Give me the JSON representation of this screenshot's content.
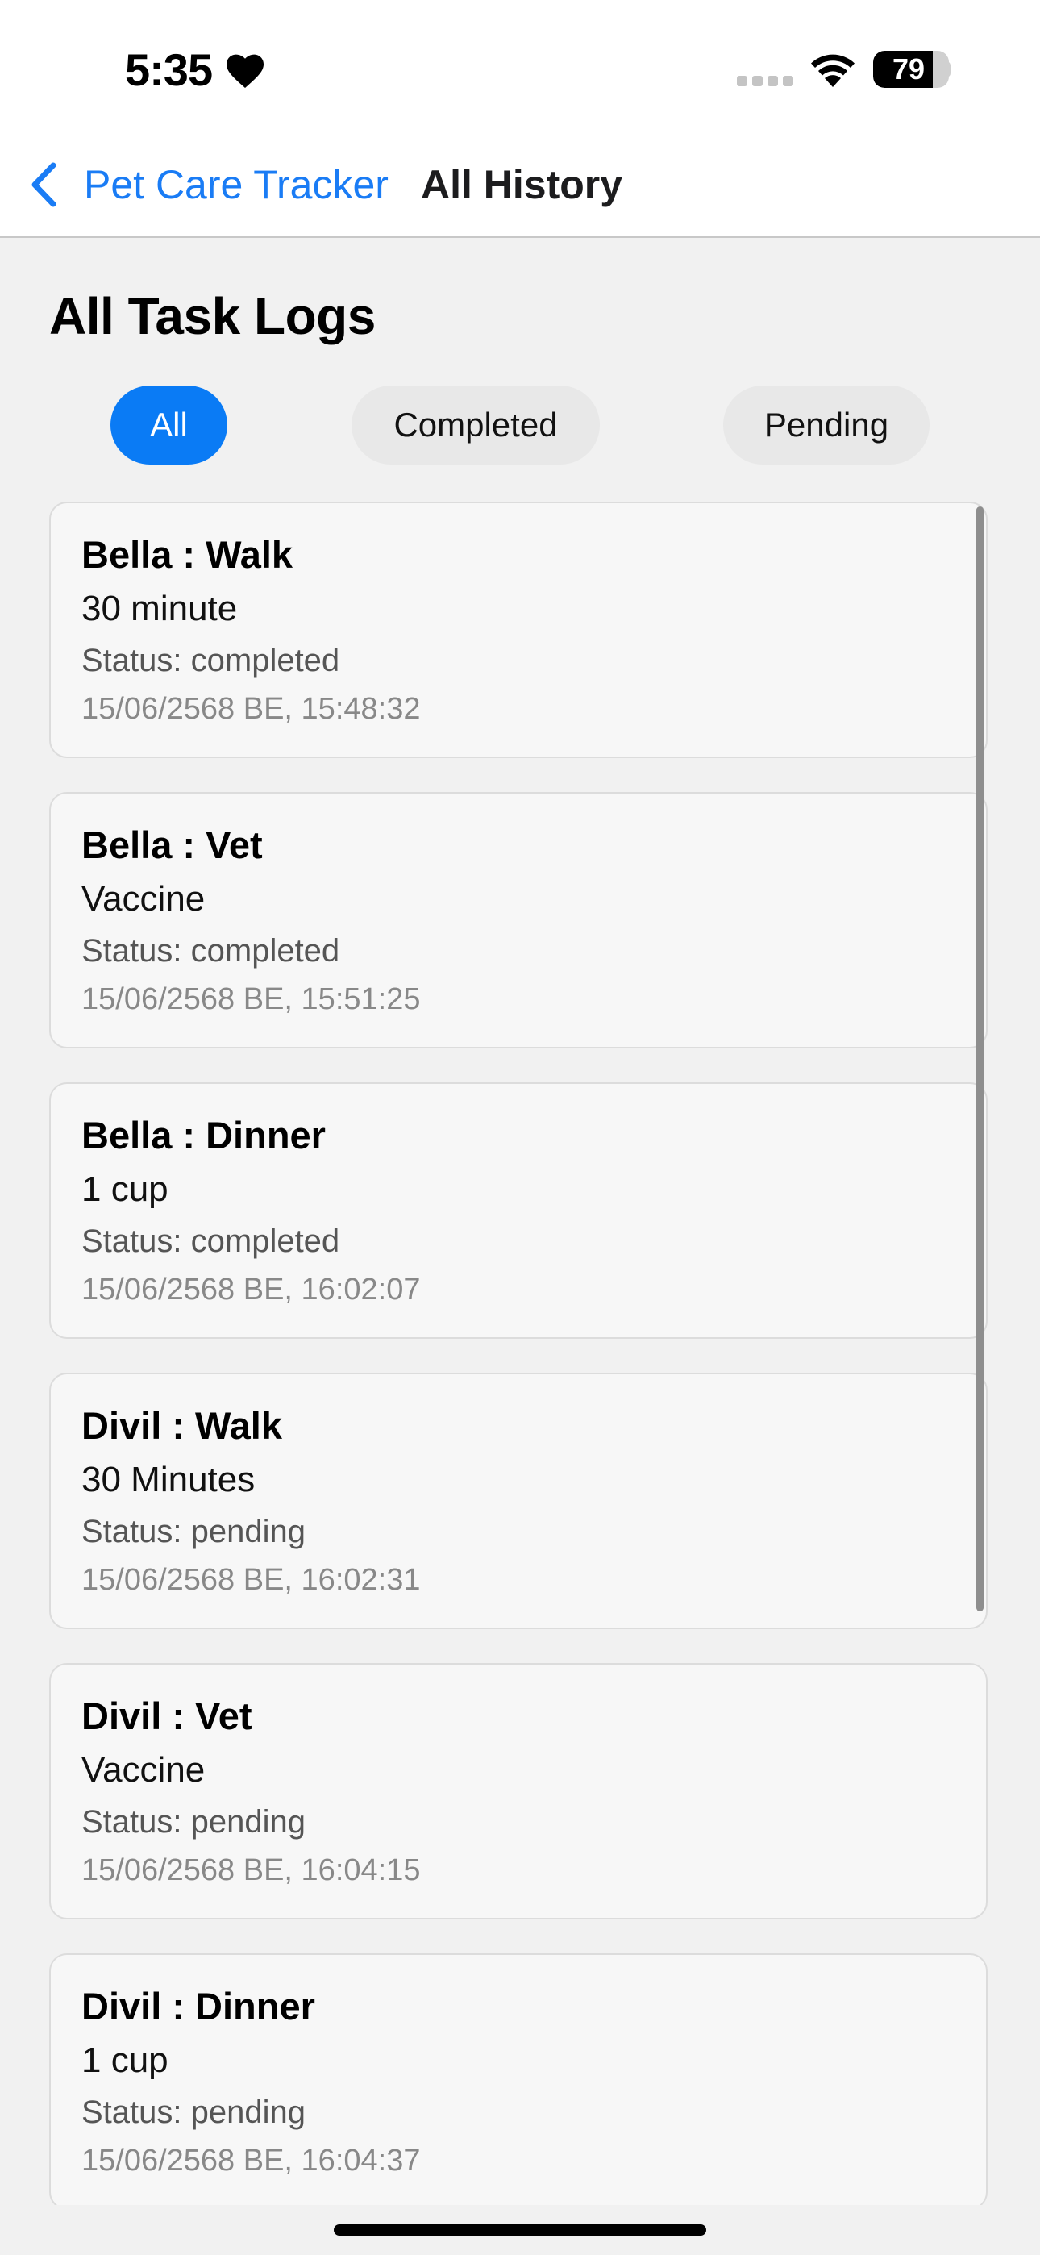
{
  "status_bar": {
    "time": "5:35",
    "heart_icon": "heart-icon",
    "signal_icon": "cellular-dots-icon",
    "wifi_icon": "wifi-icon",
    "battery_level": "79",
    "battery_fraction": 0.79
  },
  "nav": {
    "back_label": "Pet Care Tracker",
    "back_icon": "chevron-left-icon",
    "title": "All History"
  },
  "page": {
    "heading": "All Task Logs"
  },
  "filters": {
    "items": [
      "All",
      "Completed",
      "Pending"
    ],
    "active": "All"
  },
  "logs": [
    {
      "title": "Bella : Walk",
      "detail": "30 minute",
      "status": "Status: completed",
      "timestamp": "15/06/2568 BE, 15:48:32"
    },
    {
      "title": "Bella : Vet",
      "detail": "Vaccine",
      "status": "Status: completed",
      "timestamp": "15/06/2568 BE, 15:51:25"
    },
    {
      "title": "Bella : Dinner",
      "detail": "1 cup",
      "status": "Status: completed",
      "timestamp": "15/06/2568 BE, 16:02:07"
    },
    {
      "title": "Divil : Walk",
      "detail": "30 Minutes",
      "status": "Status: pending",
      "timestamp": "15/06/2568 BE, 16:02:31"
    },
    {
      "title": "Divil : Vet",
      "detail": "Vaccine",
      "status": "Status: pending",
      "timestamp": "15/06/2568 BE, 16:04:15"
    },
    {
      "title": "Divil : Dinner",
      "detail": "1 cup",
      "status": "Status: pending",
      "timestamp": "15/06/2568 BE, 16:04:37"
    }
  ],
  "colors": {
    "accent": "#0a7bf5",
    "link": "#1a7cf5",
    "background": "#f1f1f1",
    "card": "#f7f7f7"
  }
}
